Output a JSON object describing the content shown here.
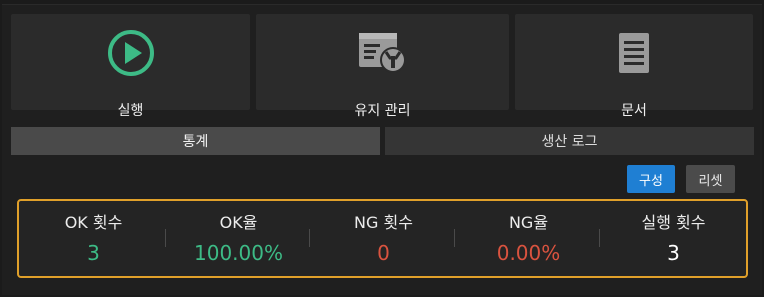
{
  "tiles": {
    "run": {
      "label": "실행",
      "icon": "play-circle-icon"
    },
    "maintenance": {
      "label": "유지 관리",
      "icon": "wrench-window-icon"
    },
    "documents": {
      "label": "문서",
      "icon": "document-icon"
    }
  },
  "tabs": [
    {
      "label": "통계",
      "active": true
    },
    {
      "label": "생산 로그",
      "active": false
    }
  ],
  "buttons": {
    "config_label": "구성",
    "reset_label": "리셋"
  },
  "stats": [
    {
      "label": "OK 횟수",
      "value": "3",
      "color": "#3dbb86"
    },
    {
      "label": "OK율",
      "value": "100.00%",
      "color": "#3dbb86"
    },
    {
      "label": "NG 횟수",
      "value": "0",
      "color": "#d9533f"
    },
    {
      "label": "NG율",
      "value": "0.00%",
      "color": "#d9533f"
    },
    {
      "label": "실행 횟수",
      "value": "3",
      "color": "#ffffff"
    }
  ],
  "colors": {
    "accent_green": "#3dbb86",
    "accent_blue": "#1f7fd3",
    "panel_border": "#e0a02a",
    "ng_red": "#d9533f"
  }
}
